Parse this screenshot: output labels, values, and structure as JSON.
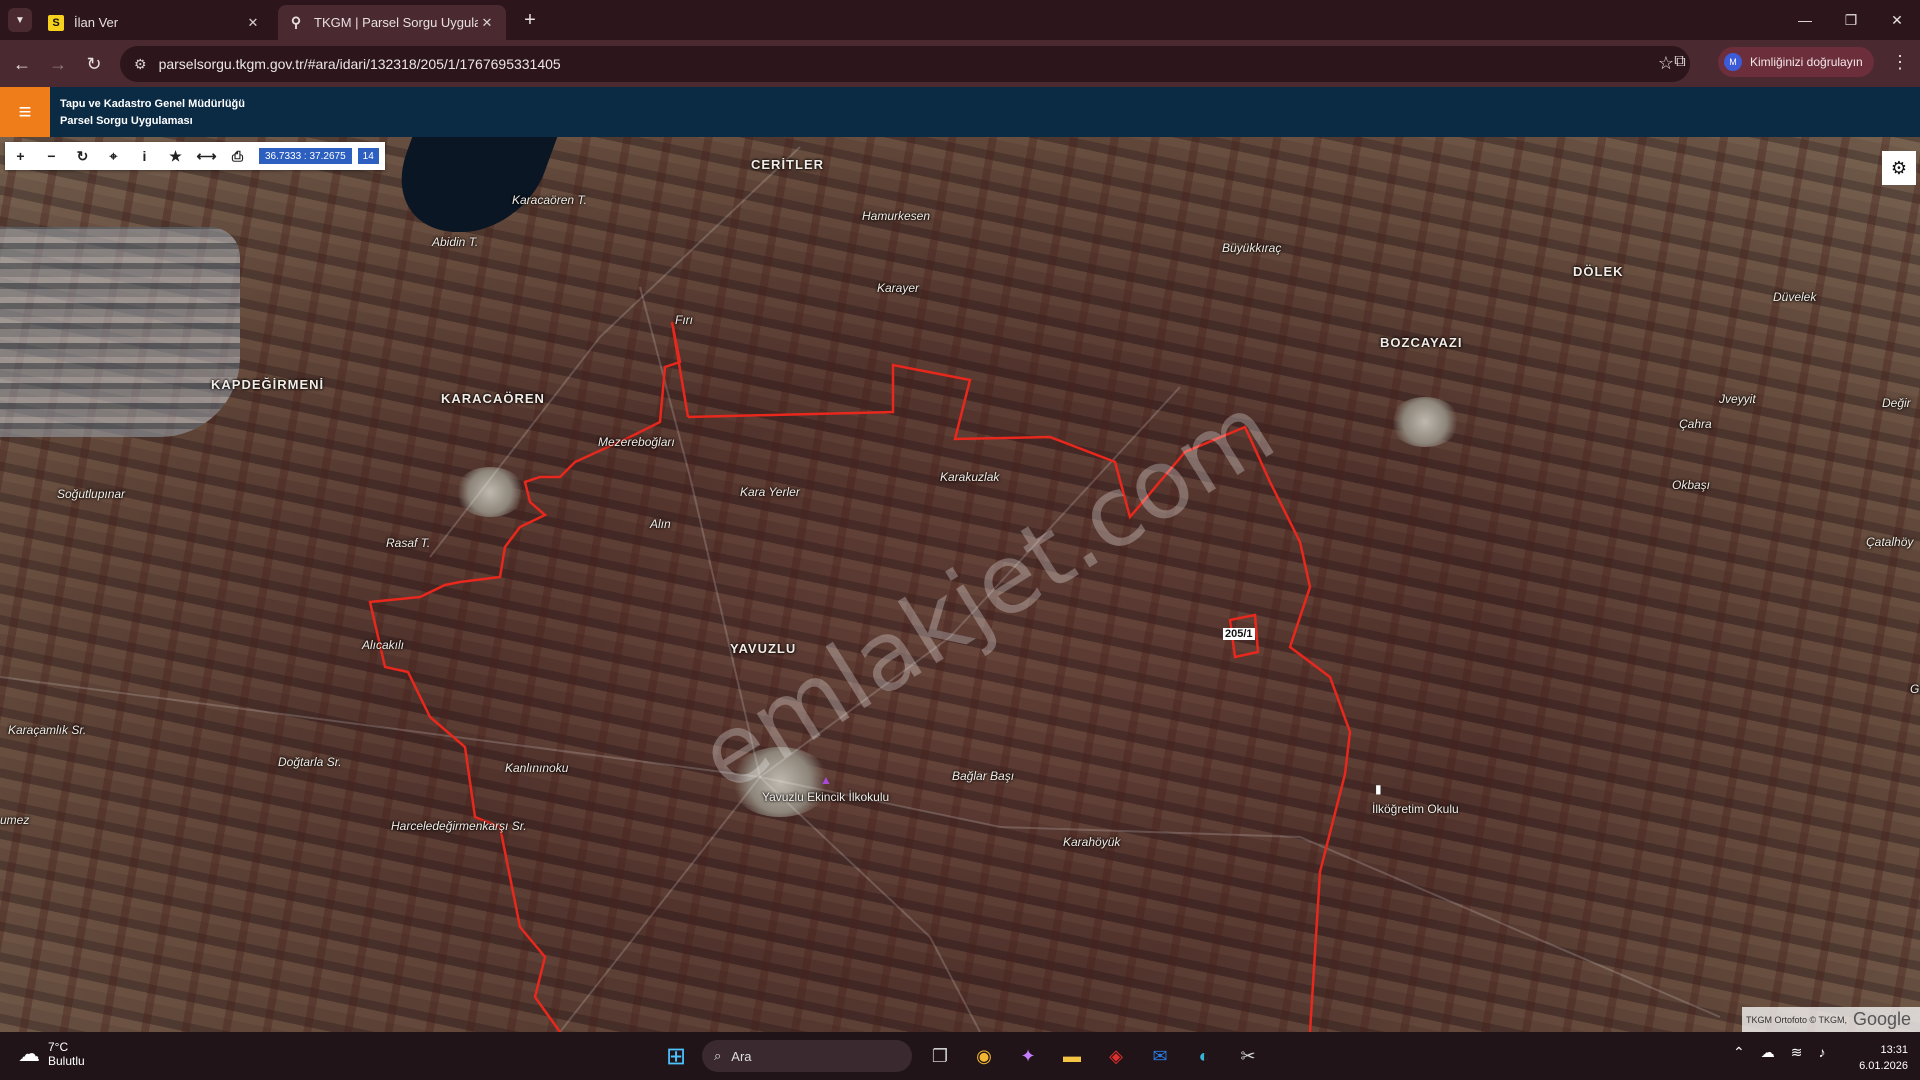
{
  "browser": {
    "tabs": [
      {
        "title": "İlan Ver",
        "favicon": "S",
        "active": false
      },
      {
        "title": "TKGM | Parsel Sorgu Uygulaması",
        "favicon": "location-pin",
        "active": true
      }
    ],
    "url": "parselsorgu.tkgm.gov.tr/#ara/idari/132318/205/1/1767695331405",
    "profile_label": "Kimliğinizi doğrulayın",
    "profile_initial": "M"
  },
  "app": {
    "org_line1": "Tapu ve Kadastro Genel Müdürlüğü",
    "org_line2": "Parsel Sorgu Uygulaması",
    "coordinates": "36.7333 : 37.2675",
    "zoom": "14",
    "parcel": "205/1",
    "watermark": "emlakjet.com",
    "attribution": "TKGM Ortofoto © TKGM,",
    "attribution_brand": "Google"
  },
  "places": [
    {
      "name": "CERİTLER",
      "big": true
    },
    {
      "name": "Karacaören T.",
      "big": false
    },
    {
      "name": "Hamurkesen",
      "big": false
    },
    {
      "name": "Abidin T.",
      "big": false
    },
    {
      "name": "Büyükkıraç",
      "big": false
    },
    {
      "name": "DÖLEK",
      "big": true
    },
    {
      "name": "Düvelek",
      "big": false
    },
    {
      "name": "Karayer",
      "big": false
    },
    {
      "name": "Fırı",
      "big": false
    },
    {
      "name": "BOZCAYAZI",
      "big": true
    },
    {
      "name": "KAPDEĞİRMENİ",
      "big": true
    },
    {
      "name": "KARACAÖREN",
      "big": true
    },
    {
      "name": "Mezereboğları",
      "big": false
    },
    {
      "name": "Jveyyit",
      "big": false
    },
    {
      "name": "Çahra",
      "big": false
    },
    {
      "name": "Değir",
      "big": false
    },
    {
      "name": "Karakuzlak",
      "big": false
    },
    {
      "name": "Kara Yerler",
      "big": false
    },
    {
      "name": "Soğutlupınar",
      "big": false
    },
    {
      "name": "Okbaşı",
      "big": false
    },
    {
      "name": "Alın",
      "big": false
    },
    {
      "name": "Rasaf T.",
      "big": false
    },
    {
      "name": "Çatalhöy",
      "big": false
    },
    {
      "name": "Alıcakılı",
      "big": false
    },
    {
      "name": "YAVUZLU",
      "big": true
    },
    {
      "name": "Karaçamlık Sr.",
      "big": false
    },
    {
      "name": "Doğtarla Sr.",
      "big": false
    },
    {
      "name": "Kanlınınoku",
      "big": false
    },
    {
      "name": "Bağlar Başı",
      "big": false
    },
    {
      "name": "Yavuzlu Ekincik İlkokulu",
      "big": false
    },
    {
      "name": "İlköğretim Okulu",
      "big": false
    },
    {
      "name": "Harceledeğirmenkarşı Sr.",
      "big": false
    },
    {
      "name": "Karahöyük",
      "big": false
    },
    {
      "name": "umez",
      "big": false
    },
    {
      "name": "G",
      "big": false
    }
  ],
  "taskbar": {
    "temperature": "7°C",
    "condition": "Bulutlu",
    "search_placeholder": "Ara",
    "time": "13:31",
    "date": "6.01.2026"
  }
}
